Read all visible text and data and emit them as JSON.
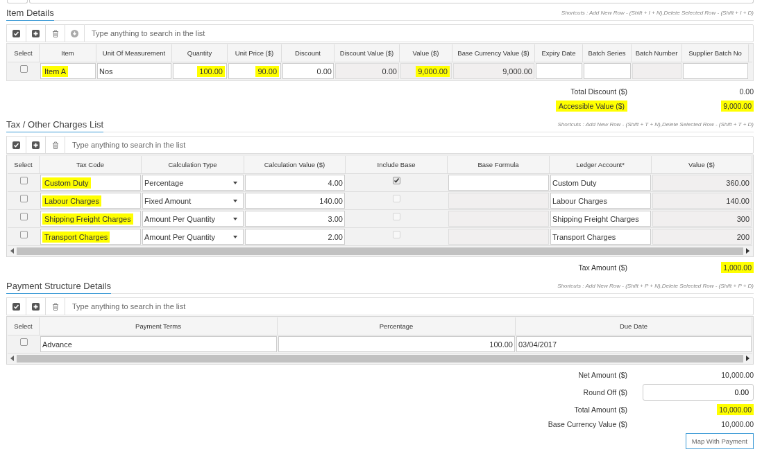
{
  "sections": [
    {
      "title": "Item Details",
      "shortcuts": "Shortcuts : Add New Row - (Shift + I + N),Delete Selected Row - (Shift + I + D)",
      "tools": [
        {
          "kind": "select_all"
        },
        {
          "kind": "add"
        },
        {
          "kind": "delete"
        },
        {
          "kind": "download"
        }
      ],
      "search": {
        "placeholder": "Type anything to search in the list"
      },
      "scrollbar": false,
      "columns": [
        "Select",
        "Item",
        "Unit Of Measurement",
        "Quantity",
        "Unit Price ($)",
        "Discount",
        "Discount Value ($)",
        "Value ($)",
        "Base Currency Value ($)",
        "Expiry Date",
        "Batch Series",
        "Batch Number",
        "Supplier Batch No"
      ],
      "rows": [
        {
          "cells": [
            {
              "kind": "check",
              "checked": false,
              "disabled": false
            },
            {
              "kind": "text",
              "text": "Item A",
              "highlighted": true
            },
            {
              "kind": "text",
              "text": "Nos",
              "highlighted": false
            },
            {
              "kind": "number",
              "text": "100.00",
              "highlighted": true
            },
            {
              "kind": "number",
              "text": "90.00",
              "highlighted": true
            },
            {
              "kind": "number",
              "text": "0.00",
              "highlighted": false
            },
            {
              "kind": "locked_number",
              "text": "0.00",
              "highlighted": false
            },
            {
              "kind": "locked_number",
              "text": "9,000.00",
              "highlighted": true
            },
            {
              "kind": "locked_number",
              "text": "9,000.00",
              "highlighted": false
            },
            {
              "kind": "text"
            },
            {
              "kind": "text"
            },
            {
              "kind": "locked"
            },
            {
              "kind": "text"
            }
          ]
        }
      ],
      "summary": [
        {
          "label": "Total Discount ($)",
          "value": "0.00",
          "kind": "text",
          "label_highlighted": false,
          "value_highlighted": false
        },
        {
          "label": "Accessible Value ($)",
          "value": "9,000.00",
          "kind": "text",
          "label_highlighted": true,
          "value_highlighted": true
        }
      ]
    },
    {
      "title": "Tax / Other Charges List",
      "shortcuts": "Shortcuts : Add New Row - (Shift + T + N),Delete Selected Row - (Shift + T + D)",
      "tools": [
        {
          "kind": "select_all"
        },
        {
          "kind": "add"
        },
        {
          "kind": "delete"
        }
      ],
      "search": {
        "placeholder": "Type anything to search in the list"
      },
      "scrollbar": true,
      "columns": [
        "Select",
        "Tax Code",
        "Calculation Type",
        "Calculation Value ($)",
        "Include Base",
        "Base Formula",
        "Ledger Account*",
        "Value ($)"
      ],
      "rows": [
        {
          "cells": [
            {
              "kind": "check",
              "checked": false,
              "disabled": false
            },
            {
              "kind": "text",
              "text": "Custom Duty",
              "highlighted": true
            },
            {
              "kind": "select",
              "text": "Percentage",
              "highlighted": false
            },
            {
              "kind": "number",
              "text": "4.00",
              "highlighted": false
            },
            {
              "kind": "check",
              "checked": true,
              "disabled": false
            },
            {
              "kind": "text"
            },
            {
              "kind": "text",
              "text": "Custom Duty",
              "highlighted": false
            },
            {
              "kind": "locked_number",
              "text": "360.00",
              "highlighted": false
            }
          ]
        },
        {
          "cells": [
            {
              "kind": "check",
              "checked": false,
              "disabled": false
            },
            {
              "kind": "text",
              "text": "Labour Charges",
              "highlighted": true
            },
            {
              "kind": "select",
              "text": "Fixed Amount",
              "highlighted": false
            },
            {
              "kind": "number",
              "text": "140.00",
              "highlighted": false
            },
            {
              "kind": "check",
              "checked": false,
              "disabled": true
            },
            {
              "kind": "locked"
            },
            {
              "kind": "text",
              "text": "Labour Charges",
              "highlighted": false
            },
            {
              "kind": "locked_number",
              "text": "140.00",
              "highlighted": false
            }
          ]
        },
        {
          "cells": [
            {
              "kind": "check",
              "checked": false,
              "disabled": false
            },
            {
              "kind": "text",
              "text": "Shipping Freight Charges",
              "highlighted": true
            },
            {
              "kind": "select",
              "text": "Amount Per Quantity",
              "highlighted": false
            },
            {
              "kind": "number",
              "text": "3.00",
              "highlighted": false
            },
            {
              "kind": "check",
              "checked": false,
              "disabled": true
            },
            {
              "kind": "locked"
            },
            {
              "kind": "text",
              "text": "Shipping Freight Charges",
              "highlighted": false
            },
            {
              "kind": "locked_number",
              "text": "300",
              "highlighted": false
            }
          ]
        },
        {
          "cells": [
            {
              "kind": "check",
              "checked": false,
              "disabled": false
            },
            {
              "kind": "text",
              "text": "Transport Charges",
              "highlighted": true
            },
            {
              "kind": "select",
              "text": "Amount Per Quantity",
              "highlighted": false
            },
            {
              "kind": "number",
              "text": "2.00",
              "highlighted": false
            },
            {
              "kind": "check",
              "checked": false,
              "disabled": true
            },
            {
              "kind": "locked"
            },
            {
              "kind": "text",
              "text": "Transport Charges",
              "highlighted": false
            },
            {
              "kind": "locked_number",
              "text": "200",
              "highlighted": false
            }
          ]
        }
      ],
      "summary": [
        {
          "label": "Tax Amount ($)",
          "value": "1,000.00",
          "kind": "text",
          "label_highlighted": false,
          "value_highlighted": true
        }
      ]
    },
    {
      "title": "Payment Structure Details",
      "shortcuts": "Shortcuts : Add New Row - (Shift + P + N),Delete Selected Row - (Shift + P + D)",
      "tools": [
        {
          "kind": "select_all"
        },
        {
          "kind": "add"
        },
        {
          "kind": "delete"
        }
      ],
      "search": {
        "placeholder": "Type anything to search in the list"
      },
      "scrollbar": true,
      "columns": [
        "Select",
        "Payment Terms",
        "Percentage",
        "Due Date"
      ],
      "rows": [
        {
          "cells": [
            {
              "kind": "check",
              "checked": false,
              "disabled": false
            },
            {
              "kind": "text",
              "text": "Advance",
              "highlighted": false
            },
            {
              "kind": "number",
              "text": "100.00",
              "highlighted": false
            },
            {
              "kind": "text",
              "text": "03/04/2017",
              "highlighted": false
            }
          ]
        }
      ],
      "summary": [
        {
          "label": "Net Amount ($)",
          "value": "10,000.00",
          "kind": "text",
          "label_highlighted": false,
          "value_highlighted": false
        },
        {
          "label": "Round Off ($)",
          "value": "0.00",
          "kind": "input",
          "label_highlighted": false,
          "value_highlighted": false
        },
        {
          "label": "Total Amount ($)",
          "value": "10,000.00",
          "kind": "text",
          "label_highlighted": false,
          "value_highlighted": true
        },
        {
          "label": "Base Currency Value ($)",
          "value": "10,000.00",
          "kind": "text",
          "label_highlighted": false,
          "value_highlighted": false
        }
      ]
    }
  ],
  "actions": [
    {
      "label": "Map With Payment"
    }
  ]
}
